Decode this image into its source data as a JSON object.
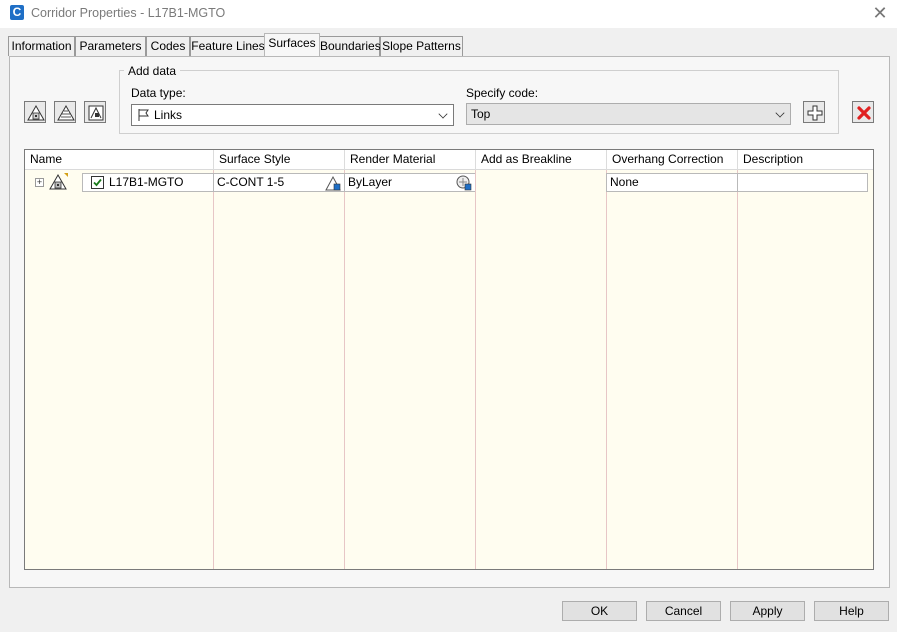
{
  "window": {
    "title": "Corridor Properties - L17B1-MGTO",
    "app_icon_letter": "C"
  },
  "tabs": [
    {
      "label": "Information"
    },
    {
      "label": "Parameters"
    },
    {
      "label": "Codes"
    },
    {
      "label": "Feature Lines"
    },
    {
      "label": "Surfaces",
      "active": true
    },
    {
      "label": "Boundaries"
    },
    {
      "label": "Slope Patterns"
    }
  ],
  "add_data": {
    "group_label": "Add data",
    "data_type_label": "Data type:",
    "data_type_value": "Links",
    "specify_code_label": "Specify code:",
    "specify_code_value": "Top"
  },
  "grid": {
    "columns": [
      "Name",
      "Surface Style",
      "Render Material",
      "Add as Breakline",
      "Overhang Correction",
      "Description"
    ],
    "rows": [
      {
        "name": "L17B1-MGTO",
        "checked": true,
        "surface_style": "C-CONT 1-5",
        "render_material": "ByLayer",
        "add_as_breakline": "",
        "overhang_correction": "None",
        "description": ""
      }
    ]
  },
  "buttons": {
    "ok": "OK",
    "cancel": "Cancel",
    "apply": "Apply",
    "help": "Help"
  },
  "colors": {
    "grid_body": "#fffdf0",
    "delete_accent": "#e02020",
    "app_icon": "#1f6fc6"
  }
}
